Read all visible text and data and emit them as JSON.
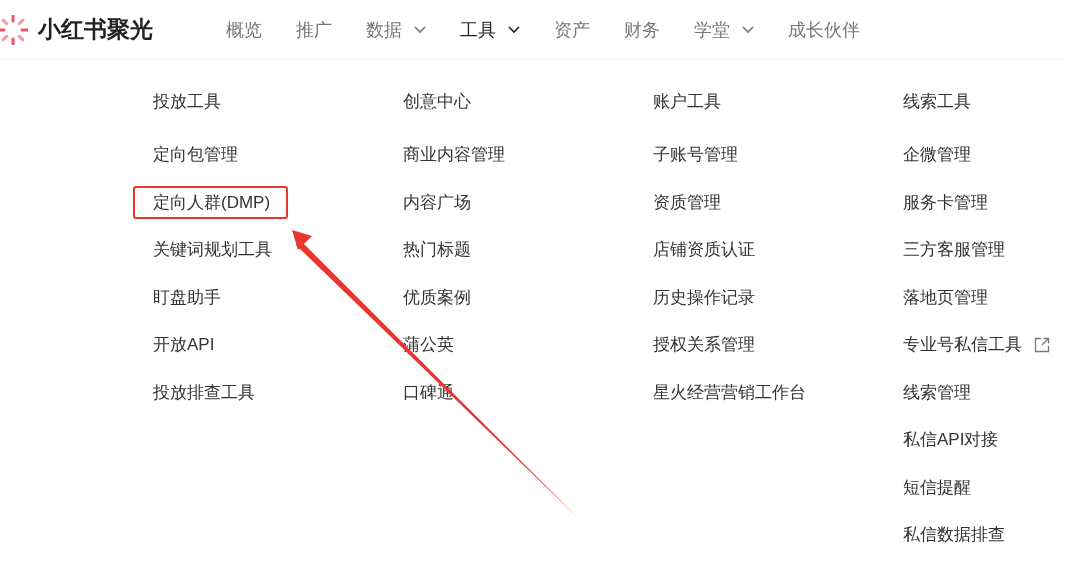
{
  "brand": {
    "name": "小红书聚光"
  },
  "nav": [
    {
      "label": "概览",
      "dropdown": false,
      "selected": false
    },
    {
      "label": "推广",
      "dropdown": false,
      "selected": false
    },
    {
      "label": "数据",
      "dropdown": true,
      "selected": false
    },
    {
      "label": "工具",
      "dropdown": true,
      "selected": true
    },
    {
      "label": "资产",
      "dropdown": false,
      "selected": false
    },
    {
      "label": "财务",
      "dropdown": false,
      "selected": false
    },
    {
      "label": "学堂",
      "dropdown": true,
      "selected": false
    },
    {
      "label": "成长伙伴",
      "dropdown": false,
      "selected": false
    }
  ],
  "menu_columns": [
    {
      "title": "投放工具",
      "items": [
        {
          "label": "定向包管理",
          "highlighted": false,
          "external": false
        },
        {
          "label": "定向人群(DMP)",
          "highlighted": true,
          "external": false
        },
        {
          "label": "关键词规划工具",
          "highlighted": false,
          "external": false
        },
        {
          "label": "盯盘助手",
          "highlighted": false,
          "external": false
        },
        {
          "label": "开放API",
          "highlighted": false,
          "external": false
        },
        {
          "label": "投放排查工具",
          "highlighted": false,
          "external": false
        }
      ]
    },
    {
      "title": "创意中心",
      "items": [
        {
          "label": "商业内容管理",
          "highlighted": false,
          "external": false
        },
        {
          "label": "内容广场",
          "highlighted": false,
          "external": false
        },
        {
          "label": "热门标题",
          "highlighted": false,
          "external": false
        },
        {
          "label": "优质案例",
          "highlighted": false,
          "external": false
        },
        {
          "label": "蒲公英",
          "highlighted": false,
          "external": false
        },
        {
          "label": "口碑通",
          "highlighted": false,
          "external": false
        }
      ]
    },
    {
      "title": "账户工具",
      "items": [
        {
          "label": "子账号管理",
          "highlighted": false,
          "external": false
        },
        {
          "label": "资质管理",
          "highlighted": false,
          "external": false
        },
        {
          "label": "店铺资质认证",
          "highlighted": false,
          "external": false
        },
        {
          "label": "历史操作记录",
          "highlighted": false,
          "external": false
        },
        {
          "label": "授权关系管理",
          "highlighted": false,
          "external": false
        },
        {
          "label": "星火经营营销工作台",
          "highlighted": false,
          "external": false
        }
      ]
    },
    {
      "title": "线索工具",
      "items": [
        {
          "label": "企微管理",
          "highlighted": false,
          "external": false
        },
        {
          "label": "服务卡管理",
          "highlighted": false,
          "external": false
        },
        {
          "label": "三方客服管理",
          "highlighted": false,
          "external": false
        },
        {
          "label": "落地页管理",
          "highlighted": false,
          "external": false
        },
        {
          "label": "专业号私信工具",
          "highlighted": false,
          "external": true
        },
        {
          "label": "线索管理",
          "highlighted": false,
          "external": false
        },
        {
          "label": "私信API对接",
          "highlighted": false,
          "external": false
        },
        {
          "label": "短信提醒",
          "highlighted": false,
          "external": false
        },
        {
          "label": "私信数据排查",
          "highlighted": false,
          "external": false
        }
      ]
    }
  ]
}
